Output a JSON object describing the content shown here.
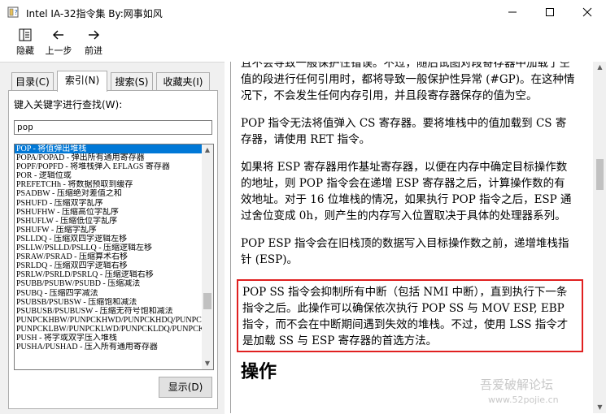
{
  "window": {
    "title": "Intel IA-32指令集 By:网事如风",
    "icon": "help-book-icon"
  },
  "toolbar": {
    "hide_label": "隐藏",
    "back_label": "上一步",
    "forward_label": "前进"
  },
  "tabs": [
    {
      "label": "目录(C)"
    },
    {
      "label": "索引(N)"
    },
    {
      "label": "搜索(S)"
    },
    {
      "label": "收藏夹(I)"
    }
  ],
  "index": {
    "keyword_label": "键入关键字进行查找(W):",
    "keyword_value": "pop",
    "display_button": "显示(D)",
    "items": [
      "POP - 将值弹出堆栈",
      "POPA/POPAD - 弹出所有通用寄存器",
      "POPF/POPFD - 将堆栈弹入 EFLAGS 寄存器",
      "POR - 逻辑位或",
      "PREFETCHh - 将数据预取到缓存",
      "PSADBW - 压缩绝对差值之和",
      "PSHUFD - 压缩双字乱序",
      "PSHUFHW - 压缩高位字乱序",
      "PSHUFLW - 压缩低位字乱序",
      "PSHUFW - 压缩字乱序",
      "PSLLDQ - 压缩双四字逻辑左移",
      "PSLLW/PSLLD/PSLLQ - 压缩逻辑左移",
      "PSRAW/PSRAD - 压缩算术右移",
      "PSRLDQ - 压缩双四字逻辑右移",
      "PSRLW/PSRLD/PSRLQ - 压缩逻辑右移",
      "PSUBB/PSUBW/PSUBD - 压缩减法",
      "PSUBQ - 压缩四字减法",
      "PSUBSB/PSUBSW - 压缩饱和减法",
      "PSUBUSB/PSUBUSW - 压缩无符号饱和减法",
      "PUNPCKHBW/PUNPCKHWD/PUNPCKHDQ/PUNPCKH",
      "PUNPCKLBW/PUNPCKLWD/PUNPCKLDQ/PUNPCKL",
      "PUSH - 将字或双字压入堆栈",
      "PUSHA/PUSHAD - 压入所有通用寄存器"
    ]
  },
  "content": {
    "paragraphs": [
      "且不会导致一般保护性错误。不过，随后试图对段寄存器中加载了空值的段进行任何引用时，都将导致一般保护性异常 (#GP)。在这种情况下，不会发生任何内存引用，并且段寄存器保存的值为空。",
      "POP 指令无法将值弹入 CS 寄存器。要将堆栈中的值加载到 CS 寄存器，请使用 RET 指令。",
      "如果将 ESP 寄存器用作基址寄存器，以便在内存中确定目标操作数的地址，则 POP 指令会在递增 ESP 寄存器之后，计算操作数的有效地址。对于 16 位堆栈的情况，如果执行 POP 指令之后，ESP 通过舍位变成 0h，则产生的内存写入位置取决于具体的处理器系列。",
      "POP ESP 指令会在旧栈顶的数据写入目标操作数之前，递增堆栈指针 (ESP)。"
    ],
    "highlighted": "POP SS 指令会抑制所有中断（包括 NMI 中断），直到执行下一条指令之后。此操作可以确保依次执行 POP SS 与 MOV ESP, EBP 指令，而不会在中断期间遇到失效的堆栈。不过，使用 LSS 指令才是加载 SS 与 ESP 寄存器的首选方法。",
    "heading": "操作",
    "highlight_color": "#e02020"
  },
  "watermark": {
    "line1": "吾爱破解论坛",
    "line2": "www.52pojie.cn"
  },
  "colors": {
    "selection": "#0078d7",
    "panel": "#f0f0f0"
  }
}
